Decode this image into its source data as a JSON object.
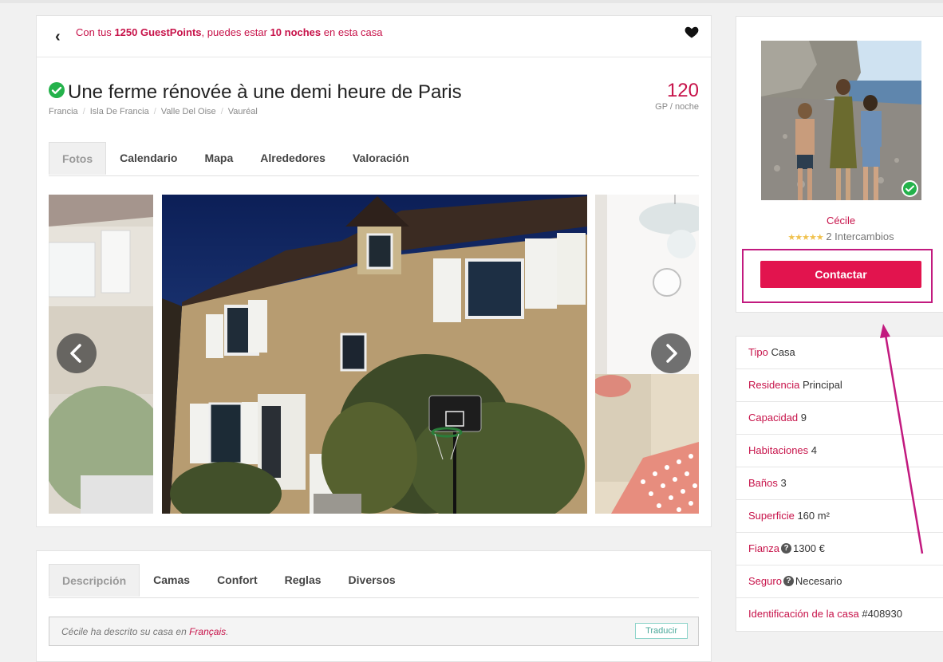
{
  "notice": {
    "prefix": "Con tus",
    "points": "1250 GuestPoints",
    "middle": ", puedes estar",
    "nights": "10 noches",
    "suffix": "en esta casa"
  },
  "listing": {
    "title": "Une ferme rénovée à une demi heure de Paris",
    "breadcrumb": [
      "Francia",
      "Isla De Francia",
      "Valle Del Oise",
      "Vauréal"
    ],
    "price": "120",
    "price_unit": "GP / noche"
  },
  "tabs": [
    "Fotos",
    "Calendario",
    "Mapa",
    "Alrededores",
    "Valoración"
  ],
  "active_tab": "Fotos",
  "desc_tabs": [
    "Descripción",
    "Camas",
    "Confort",
    "Reglas",
    "Diversos"
  ],
  "description": {
    "prefix": "Cécile ha descrito su casa en",
    "language": "Français",
    "suffix": ".",
    "translate_label": "Traducir"
  },
  "host": {
    "name": "Cécile",
    "stars": "★★★★★",
    "rating_value": 5,
    "exchanges": "2 Intercambios",
    "contact_label": "Contactar"
  },
  "details": [
    {
      "label": "Tipo",
      "value": "Casa",
      "help": false
    },
    {
      "label": "Residencia",
      "value": "Principal",
      "help": false
    },
    {
      "label": "Capacidad",
      "value": "9",
      "help": false
    },
    {
      "label": "Habitaciones",
      "value": "4",
      "help": false
    },
    {
      "label": "Baños",
      "value": "3",
      "help": false
    },
    {
      "label": "Superficie",
      "value": "160 m²",
      "help": false
    },
    {
      "label": "Fianza",
      "value": "1300 €",
      "help": true
    },
    {
      "label": "Seguro",
      "value": "Necesario",
      "help": true
    },
    {
      "label": "Identificación de la casa",
      "value": "#408930",
      "help": false
    }
  ],
  "colors": {
    "brand": "#e2144e",
    "accent_text": "#c7134a",
    "verified": "#24b24b",
    "annotation": "#c21a7f"
  }
}
